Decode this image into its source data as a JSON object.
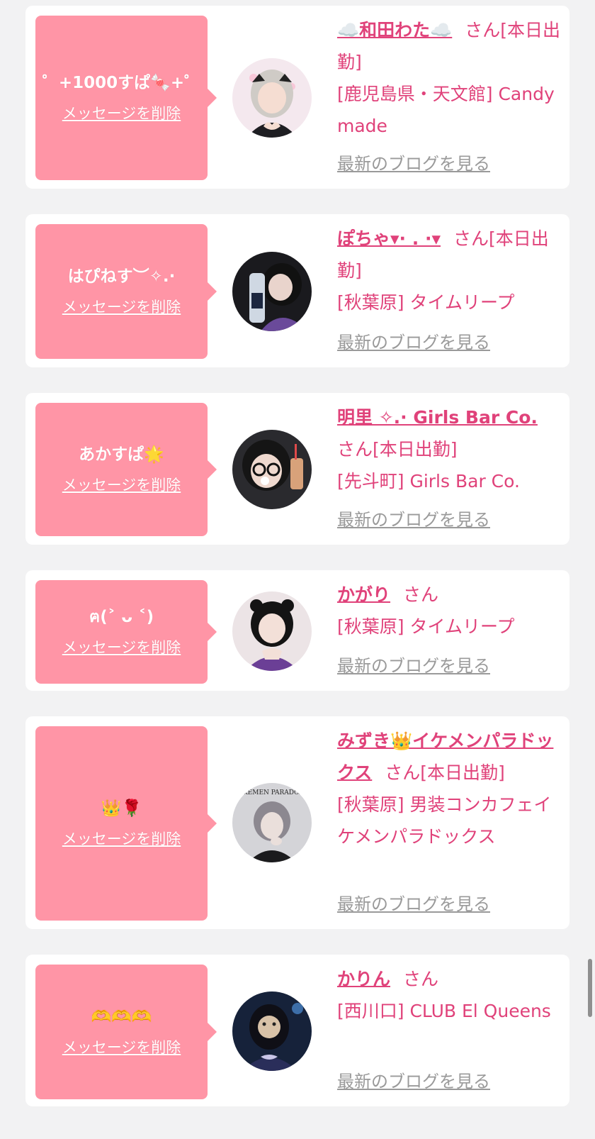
{
  "colors": {
    "page_bg": "#f2f2f3",
    "card_bg": "#ffffff",
    "message_box": "#ff95a6",
    "name_pink": "#e0427a",
    "blog_gray": "#9a9a9a"
  },
  "delete_label": "メッセージを削除",
  "blog_label": "最新のブログを見る",
  "cards": [
    {
      "message": "゜+1000すぱ🍬+゜",
      "name": "☁️和田わた☁️",
      "san": "さん",
      "status": "[本日出勤]",
      "location": "[鹿児島県・天文館] Candy made",
      "avatar_icon": "avatar-photo"
    },
    {
      "message": "はぴねす︶✧.·",
      "name": "ぽちゃ▾· . ·▾",
      "san": "さん",
      "status": "[本日出勤]",
      "location": "[秋葉原] タイムリープ",
      "avatar_icon": "avatar-photo"
    },
    {
      "message": "あかすぱ🌟",
      "name": "明里 ✧.· Girls Bar Co.",
      "san": "さん",
      "status": "[本日出勤]",
      "location": "[先斗町] Girls Bar Co.",
      "avatar_icon": "avatar-photo"
    },
    {
      "message": "ฅ(˃ ᴗ ˂)",
      "name": "かがり",
      "san": "さん",
      "status": "",
      "location": "[秋葉原] タイムリープ",
      "avatar_icon": "avatar-photo"
    },
    {
      "message": "👑🌹",
      "name": "みずき👑イケメンパラドックス",
      "san": "さん",
      "status": "[本日出勤]",
      "location": "[秋葉原] 男装コンカフェイケメンパラドックス",
      "avatar_icon": "avatar-photo",
      "avatar_caption": "IKEMEN PARADOX"
    },
    {
      "message": "🫶🫶🫶",
      "name": "かりん",
      "san": "さん",
      "status": "",
      "location": "[西川口] CLUB El Queens",
      "avatar_icon": "avatar-photo"
    }
  ]
}
